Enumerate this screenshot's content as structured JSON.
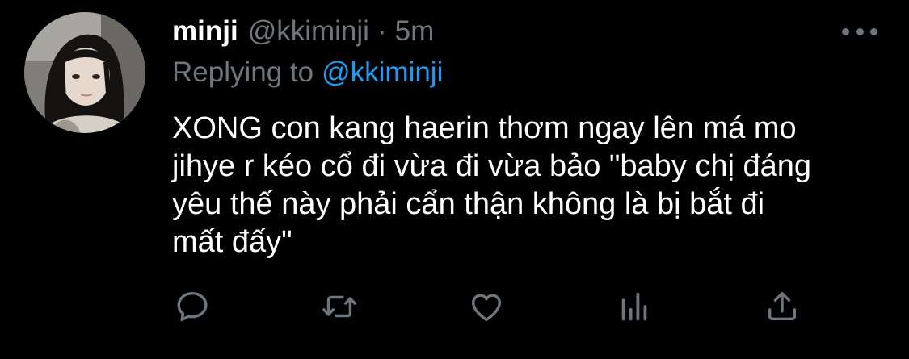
{
  "tweet": {
    "display_name": "minji",
    "handle": "@kkiminji",
    "separator": "·",
    "time": "5m",
    "reply_label": "Replying to",
    "reply_mention": "@kkiminji",
    "text": "XONG con kang haerin thơm ngay lên má mo\njihye r kéo cổ đi vừa đi vừa bảo \"baby chị đáng\nyêu thế này phải cẩn thận không là bị bắt đi\nmất đấy\""
  },
  "actions": [
    {
      "name": "reply",
      "icon": "speech-bubble-icon"
    },
    {
      "name": "retweet",
      "icon": "retweet-arrows-icon"
    },
    {
      "name": "like",
      "icon": "heart-icon"
    },
    {
      "name": "analytics",
      "icon": "bar-chart-icon"
    },
    {
      "name": "share",
      "icon": "share-upload-icon"
    }
  ],
  "colors": {
    "background": "#000000",
    "text": "#ffffff",
    "muted": "#6e767d",
    "link": "#1d9bf0"
  }
}
